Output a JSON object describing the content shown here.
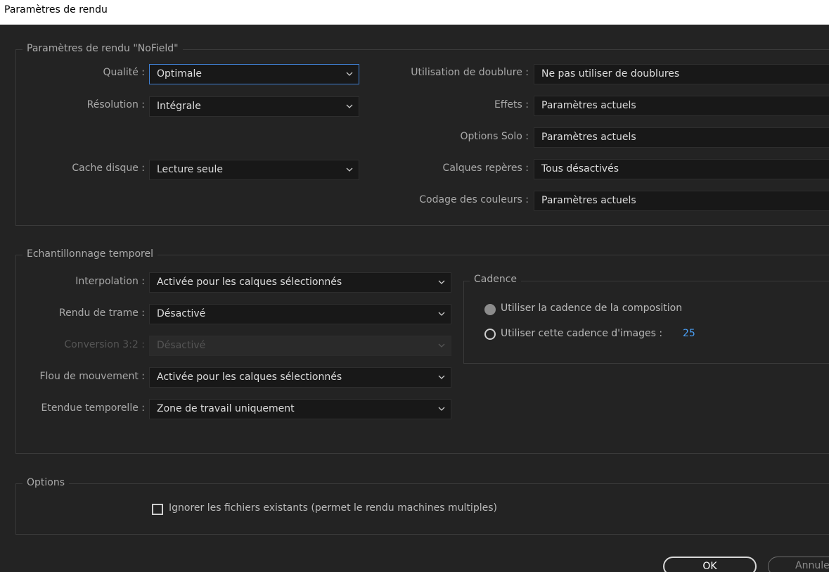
{
  "window": {
    "title": "Paramètres de rendu"
  },
  "render": {
    "group_title": "Paramètres de rendu \"NoField\"",
    "quality": {
      "label": "Qualité :",
      "value": "Optimale"
    },
    "resolution": {
      "label": "Résolution :",
      "value": "Intégrale"
    },
    "disk_cache": {
      "label": "Cache disque :",
      "value": "Lecture seule"
    },
    "proxy_use": {
      "label": "Utilisation de doublure :",
      "value": "Ne pas utiliser de doublures"
    },
    "effects": {
      "label": "Effets :",
      "value": "Paramètres actuels"
    },
    "solo": {
      "label": "Options Solo :",
      "value": "Paramètres actuels"
    },
    "guide_layers": {
      "label": "Calques repères :",
      "value": "Tous désactivés"
    },
    "color_depth": {
      "label": "Codage des couleurs :",
      "value": "Paramètres actuels"
    }
  },
  "time_sampling": {
    "group_title": "Echantillonnage temporel",
    "frame_blending": {
      "label": "Interpolation :",
      "value": "Activée pour les calques sélectionnés"
    },
    "field_render": {
      "label": "Rendu de trame :",
      "value": "Désactivé"
    },
    "pulldown": {
      "label": "Conversion 3:2 :",
      "value": "Désactivé"
    },
    "motion_blur": {
      "label": "Flou de mouvement :",
      "value": "Activée pour les calques sélectionnés"
    },
    "time_span": {
      "label": "Etendue temporelle :",
      "value": "Zone de travail uniquement"
    }
  },
  "frame_rate": {
    "group_title": "Cadence",
    "use_comp": "Utiliser la cadence de la composition",
    "use_this": "Utiliser cette cadence d'images :",
    "value": "25"
  },
  "options": {
    "group_title": "Options",
    "skip_existing": "Ignorer les fichiers existants (permet le rendu machines multiples)"
  },
  "buttons": {
    "ok": "OK",
    "cancel": "Annule"
  },
  "colors": {
    "focus": "#3f7fd1",
    "value_blue": "#4a9ff5"
  }
}
